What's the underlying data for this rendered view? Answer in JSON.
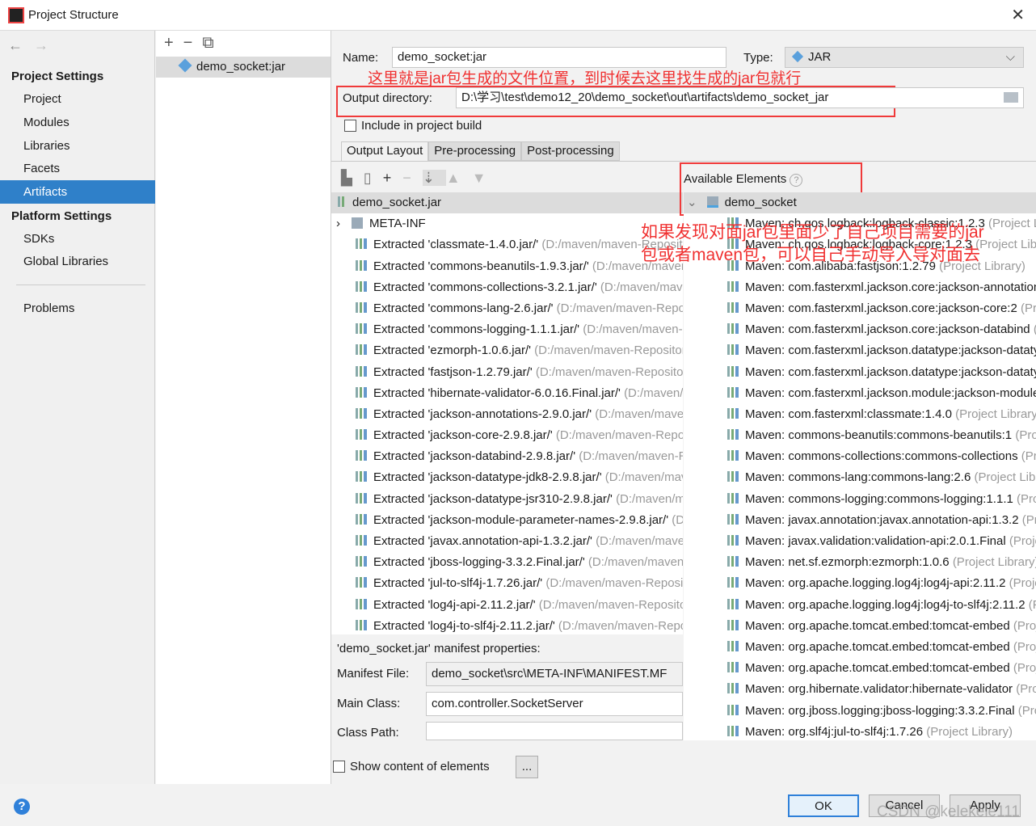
{
  "window": {
    "title": "Project Structure",
    "close": "✕"
  },
  "sidebar": {
    "back": "←",
    "forward": "→",
    "project_settings": "Project Settings",
    "items": [
      "Project",
      "Modules",
      "Libraries",
      "Facets",
      "Artifacts"
    ],
    "platform_settings": "Platform Settings",
    "platform_items": [
      "SDKs",
      "Global Libraries"
    ],
    "problems": "Problems"
  },
  "artifacts_list": {
    "toolbar": "+−⧉",
    "items": [
      "demo_socket:jar"
    ]
  },
  "form": {
    "name_label": "Name:",
    "name_value": "demo_socket:jar",
    "type_label": "Type:",
    "type_value": "JAR",
    "output_label": "Output directory:",
    "output_value": "D:\\学习\\test\\demo12_20\\demo_socket\\out\\artifacts\\demo_socket_jar",
    "include_label": "Include in project build"
  },
  "annotations": {
    "top": "这里就是jar包生成的文件位置，到时候去这里找生成的jar包就行",
    "middle_line1": "如果发现对面jar包里面少了自己项目需要的jar",
    "middle_line2": "包或者maven包，可以自己手动导入导对面去"
  },
  "tabs": [
    "Output Layout",
    "Pre-processing",
    "Post-processing"
  ],
  "layout": {
    "root": "demo_socket.jar",
    "meta": "META-INF",
    "path_hint": "(D:/maven/maven-Repository)",
    "items": [
      "classmate-1.4.0.jar/",
      "commons-beanutils-1.9.3.jar/",
      "commons-collections-3.2.1.jar/",
      "commons-lang-2.6.jar/",
      "commons-logging-1.1.1.jar/",
      "ezmorph-1.0.6.jar/",
      "fastjson-1.2.79.jar/",
      "hibernate-validator-6.0.16.Final.jar/",
      "jackson-annotations-2.9.0.jar/",
      "jackson-core-2.9.8.jar/",
      "jackson-databind-2.9.8.jar/",
      "jackson-datatype-jdk8-2.9.8.jar/",
      "jackson-datatype-jsr310-2.9.8.jar/",
      "jackson-module-parameter-names-2.9.8.jar/",
      "javax.annotation-api-1.3.2.jar/",
      "jboss-logging-3.3.2.Final.jar/",
      "jul-to-slf4j-1.7.26.jar/",
      "log4j-api-2.11.2.jar/",
      "log4j-to-slf4j-2.11.2.jar/"
    ],
    "extracted_prefix": "Extracted"
  },
  "available": {
    "title": "Available Elements",
    "help": "?",
    "root": "demo_socket",
    "suffix": "(Project Library)",
    "items": [
      "Maven: ch.qos.logback:logback-classic:1.2.3",
      "Maven: ch.qos.logback:logback-core:1.2.3",
      "Maven: com.alibaba:fastjson:1.2.79",
      "Maven: com.fasterxml.jackson.core:jackson-annotations",
      "Maven: com.fasterxml.jackson.core:jackson-core:2",
      "Maven: com.fasterxml.jackson.core:jackson-databind",
      "Maven: com.fasterxml.jackson.datatype:jackson-datatype",
      "Maven: com.fasterxml.jackson.datatype:jackson-datatype",
      "Maven: com.fasterxml.jackson.module:jackson-module",
      "Maven: com.fasterxml:classmate:1.4.0",
      "Maven: commons-beanutils:commons-beanutils:1",
      "Maven: commons-collections:commons-collections",
      "Maven: commons-lang:commons-lang:2.6",
      "Maven: commons-logging:commons-logging:1.1.1",
      "Maven: javax.annotation:javax.annotation-api:1.3.2",
      "Maven: javax.validation:validation-api:2.0.1.Final",
      "Maven: net.sf.ezmorph:ezmorph:1.0.6",
      "Maven: org.apache.logging.log4j:log4j-api:2.11.2",
      "Maven: org.apache.logging.log4j:log4j-to-slf4j:2.11.2",
      "Maven: org.apache.tomcat.embed:tomcat-embed",
      "Maven: org.apache.tomcat.embed:tomcat-embed",
      "Maven: org.apache.tomcat.embed:tomcat-embed",
      "Maven: org.hibernate.validator:hibernate-validator",
      "Maven: org.jboss.logging:jboss-logging:3.3.2.Final",
      "Maven: org.slf4j:jul-to-slf4j:1.7.26"
    ]
  },
  "manifest": {
    "title": "'demo_socket.jar' manifest properties:",
    "file_label": "Manifest File:",
    "file_value": "demo_socket\\src\\META-INF\\MANIFEST.MF",
    "main_label": "Main Class:",
    "main_value": "com.controller.SocketServer",
    "cp_label": "Class Path:",
    "cp_value": ""
  },
  "bottom": {
    "show_content": "Show content of elements",
    "more": "...",
    "ok": "OK",
    "cancel": "Cancel",
    "apply": "Apply",
    "watermark": "CSDN @kelekele111",
    "help": "?"
  }
}
